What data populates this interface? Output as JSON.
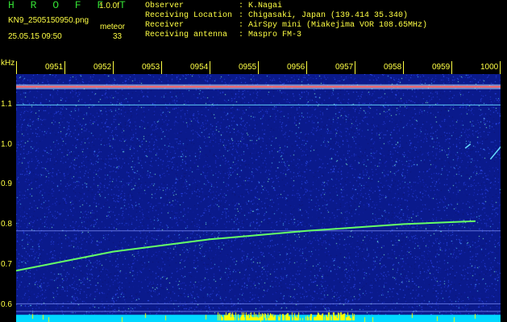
{
  "header": {
    "app_title": "H R O F F T",
    "version": "1.0.0f",
    "filename": "KN9_2505150950.png",
    "meteor_label": "meteor",
    "timestamp": "25.05.15 09:50",
    "meteor_count": "33",
    "info": [
      {
        "key": "Observer",
        "value": "K.Nagai"
      },
      {
        "key": "Receiving Location",
        "value": "Chigasaki, Japan (139.414 35.340)"
      },
      {
        "key": "Receiver",
        "value": "AirSpy mini (Miakejima VOR 108.65MHz)"
      },
      {
        "key": "Receiving antenna",
        "value": "Maspro FM-3"
      }
    ],
    "separator": ":"
  },
  "axes": {
    "unit": "kHz",
    "time_ticks": [
      "0951",
      "0952",
      "0953",
      "0954",
      "0955",
      "0956",
      "0957",
      "0958",
      "0959",
      "1000"
    ],
    "freq_ticks": [
      "1.1",
      "1.0",
      "0.9",
      "0.8",
      "0.7",
      "0.6"
    ]
  },
  "colors": {
    "background": "#000000",
    "label": "#ffff44",
    "title": "#33dd33",
    "noise_base": "#0a1a8c",
    "carrier": "#ff6666",
    "trail": "#66ff66",
    "bottom_band": "#00d8ff",
    "bottom_spikes": "#ffff00"
  },
  "spectrogram": {
    "freq_range_khz": [
      0.58,
      1.165
    ],
    "time_range": [
      "0950",
      "1000"
    ],
    "carrier_khz": 1.135,
    "steady_lines_khz": [
      1.092,
      0.795,
      0.623,
      0.605
    ],
    "meteor_trail": [
      [
        0.0,
        0.701
      ],
      [
        2.0,
        0.746
      ],
      [
        4.0,
        0.775
      ],
      [
        6.0,
        0.795
      ],
      [
        8.0,
        0.811
      ],
      [
        9.47,
        0.818
      ]
    ],
    "short_streaks": [
      [
        [
          9.27,
          0.99
        ],
        [
          9.38,
          1.0
        ]
      ],
      [
        [
          9.79,
          0.964
        ],
        [
          10.16,
          1.015
        ]
      ]
    ]
  }
}
